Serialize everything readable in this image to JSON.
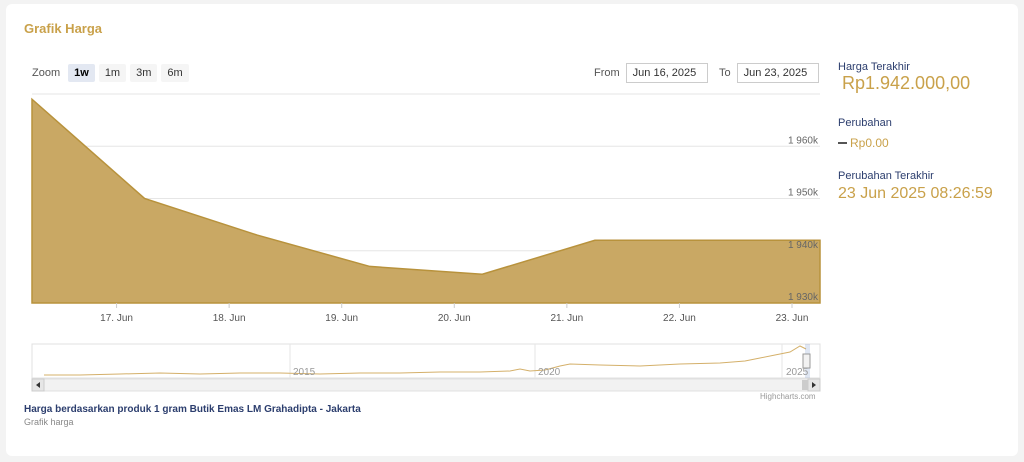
{
  "page": {
    "title": "Grafik Harga",
    "footer_title": "Harga berdasarkan produk 1 gram Butik Emas LM Grahadipta - Jakarta",
    "footer_subtitle": "Grafik harga",
    "credits": "Highcharts.com"
  },
  "controls": {
    "zoom_label": "Zoom",
    "zoom_options": [
      "1w",
      "1m",
      "3m",
      "6m"
    ],
    "zoom_active": "1w",
    "from_label": "From",
    "from_value": "Jun 16, 2025",
    "to_label": "To",
    "to_value": "Jun 23, 2025"
  },
  "info": {
    "last_price_label": "Harga Terakhir",
    "last_price_value": "Rp1.942.000,00",
    "change_label": "Perubahan",
    "change_value": "Rp0.00",
    "last_change_label": "Perubahan Terakhir",
    "last_change_value": "23 Jun 2025 08:26:59"
  },
  "colors": {
    "area_fill": "#c9a864",
    "area_line": "#b8923c",
    "accent": "#c9a14a"
  },
  "chart_data": {
    "type": "area",
    "x": [
      "2025-06-16",
      "2025-06-17",
      "2025-06-18",
      "2025-06-19",
      "2025-06-20",
      "2025-06-21",
      "2025-06-22",
      "2025-06-23"
    ],
    "values": [
      1969000,
      1950000,
      1943000,
      1937000,
      1935500,
      1942000,
      1942000,
      1942000
    ],
    "x_ticks": [
      "17. Jun",
      "18. Jun",
      "19. Jun",
      "20. Jun",
      "21. Jun",
      "22. Jun",
      "23. Jun"
    ],
    "y_ticks": [
      "1 930k",
      "1 940k",
      "1 950k",
      "1 960k"
    ],
    "y_tick_values": [
      1930000,
      1940000,
      1950000,
      1960000
    ],
    "ylim": [
      1930000,
      1970000
    ],
    "grid": true,
    "navigator": {
      "year_labels": [
        "2015",
        "2020",
        "2025"
      ]
    }
  }
}
